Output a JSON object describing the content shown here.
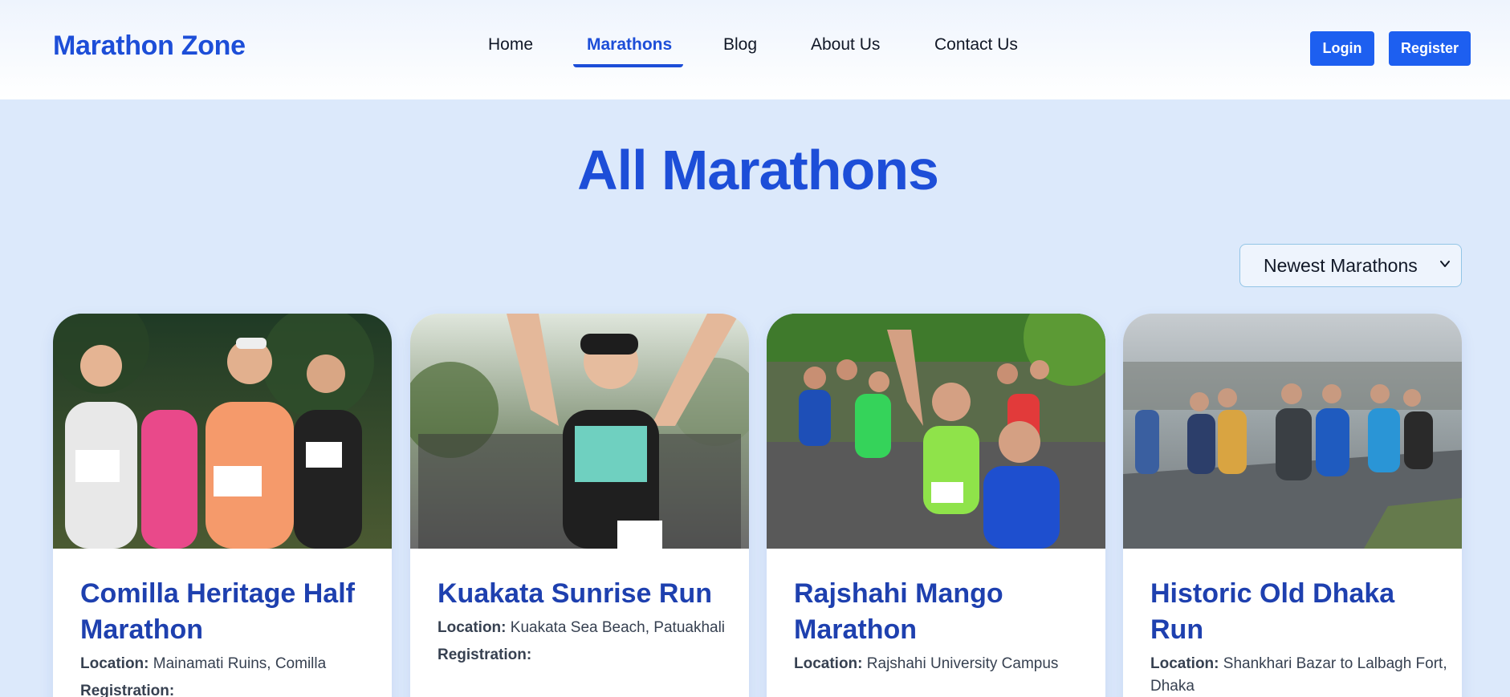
{
  "brand": "Marathon Zone",
  "nav": {
    "items": [
      {
        "label": "Home"
      },
      {
        "label": "Marathons"
      },
      {
        "label": "Blog"
      },
      {
        "label": "About Us"
      },
      {
        "label": "Contact Us"
      }
    ],
    "active": "Marathons"
  },
  "auth": {
    "login_label": "Login",
    "register_label": "Register"
  },
  "page_title": "All Marathons",
  "sort": {
    "selected": "Newest Marathons"
  },
  "labels": {
    "location": "Location:",
    "registration": "Registration:"
  },
  "cards": [
    {
      "title": "Comilla Heritage Half Marathon",
      "location": "Mainamati Ruins, Comilla",
      "image": "runners-group-photo"
    },
    {
      "title": "Kuakata Sunrise Run",
      "location": "Kuakata Sea Beach, Patuakhali",
      "image": "runner-celebrating-photo"
    },
    {
      "title": "Rajshahi Mango Marathon",
      "location": "Rajshahi University Campus",
      "image": "crowd-race-photo"
    },
    {
      "title": "Historic Old Dhaka Run",
      "location": "Shankhari Bazar to Lalbagh Fort, Dhaka",
      "image": "rainy-race-photo"
    }
  ],
  "colors": {
    "accent": "#1d4ed8",
    "button": "#1d5ff0",
    "background": "#dce9fb"
  }
}
